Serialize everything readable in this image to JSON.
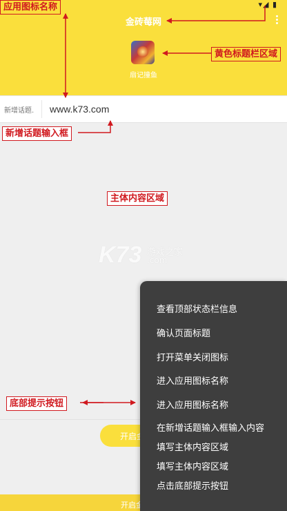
{
  "status_bar": {
    "icons": "▾◢ ▮"
  },
  "header": {
    "title": "金砖莓网",
    "app_name": "扇记撞鱼"
  },
  "topic_bar": {
    "label": "新增话题.",
    "value": "www.k73.com"
  },
  "watermark": {
    "main": "K73",
    "sub": "游戏之家",
    "domain": ".com"
  },
  "bottom": {
    "prompt_button_label": "开启金砖莓网",
    "bar_label": "开启金砖莓网"
  },
  "menu": {
    "items": [
      "查看顶部状态栏信息",
      "确认页面标题",
      "打开菜单关闭图标",
      "进入应用图标名称",
      "进入应用图标名称",
      "在新增话题输入框输入内容",
      "填写主体内容区域",
      "填写主体内容区域",
      "点击底部提示按钮"
    ]
  },
  "annotations": {
    "app_icon_name": "应用图标名称",
    "yellow_title_area": "黄色标题栏区域",
    "topic_input_box": "新增话题输入框",
    "main_content_area": "主体内容区域",
    "bottom_prompt_button": "底部提示按钮"
  },
  "colors": {
    "header_yellow": "#fadf3c",
    "annotation_red": "#d0191f",
    "menu_background": "#3e3e3e",
    "page_background": "#efefef"
  }
}
